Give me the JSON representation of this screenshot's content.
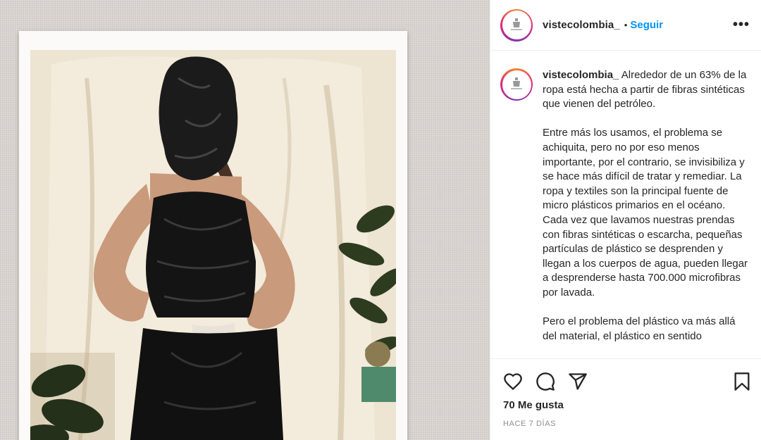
{
  "post": {
    "username": "vistecolombia_",
    "dot": "•",
    "follow_label": "Seguir",
    "more_label": "•••",
    "caption_paragraphs": [
      "Alrededor de un 63% de la ropa está hecha a partir de fibras sintéticas que vienen del petróleo.",
      "Entre más los usamos, el problema se achiquita, pero no por eso menos importante, por el contrario, se invisibiliza y se hace más difícil de tratar y remediar. La ropa y textiles son la principal fuente de micro plásticos primarios en el océano. Cada vez que lavamos nuestras prendas con fibras sintéticas o escarcha, pequeñas partículas de plástico se desprenden y llegan a los cuerpos de agua, pueden llegar a desprenderse hasta 700.000 microfibras por lavada.",
      "Pero el problema del plástico va más allá del material, el plástico en sentido"
    ],
    "likes": "70 Me gusta",
    "time": "HACE 7 DÍAS"
  },
  "icons": {
    "like": "heart-icon",
    "comment": "comment-icon",
    "share": "share-icon",
    "save": "bookmark-icon",
    "avatar": "avatar-logo-icon"
  },
  "colors": {
    "follow": "#0095f6",
    "text": "#262626",
    "muted": "#8e8e8e"
  }
}
